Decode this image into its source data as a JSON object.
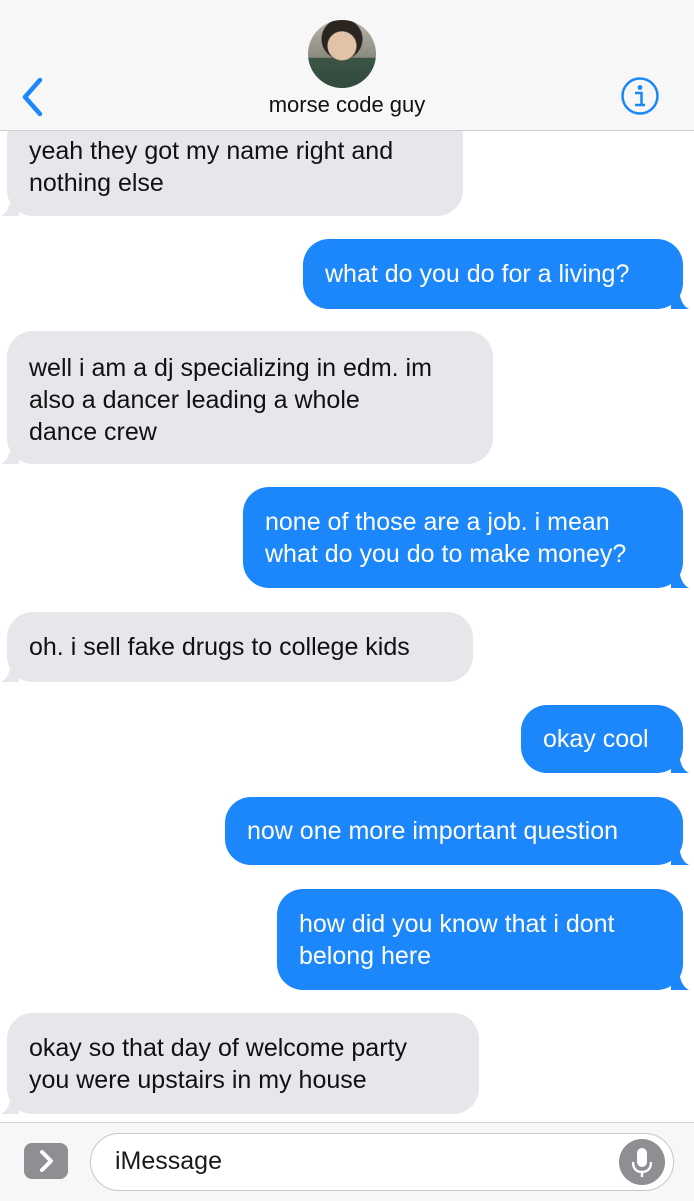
{
  "header": {
    "contact_name": "morse code guy",
    "back_icon": "chevron-left-icon",
    "info_icon": "info-icon"
  },
  "messages": [
    {
      "side": "received",
      "lines": [
        "yeah they got my name right and",
        "nothing else"
      ]
    },
    {
      "side": "sent",
      "lines": [
        "what do you do for a living?"
      ]
    },
    {
      "side": "received",
      "lines": [
        "well i am a dj specializing in edm. im",
        "also a dancer leading a whole",
        "dance crew"
      ]
    },
    {
      "side": "sent",
      "lines": [
        "none of those are a job. i mean",
        "what do you do to make money?"
      ]
    },
    {
      "side": "received",
      "lines": [
        "oh. i sell fake drugs to college kids"
      ]
    },
    {
      "side": "sent",
      "lines": [
        "okay cool"
      ]
    },
    {
      "side": "sent",
      "lines": [
        "now one more important question"
      ]
    },
    {
      "side": "sent",
      "lines": [
        "how did you know that i dont",
        "belong here"
      ]
    },
    {
      "side": "received",
      "lines": [
        "okay so that day of welcome party",
        "you were upstairs in my house"
      ]
    }
  ],
  "input": {
    "placeholder": "iMessage",
    "expand_icon": "chevron-right-icon",
    "mic_icon": "microphone-icon"
  },
  "colors": {
    "sent_bubble": "#1b87fb",
    "received_bubble": "#e6e6eb",
    "accent": "#1b87fb"
  }
}
